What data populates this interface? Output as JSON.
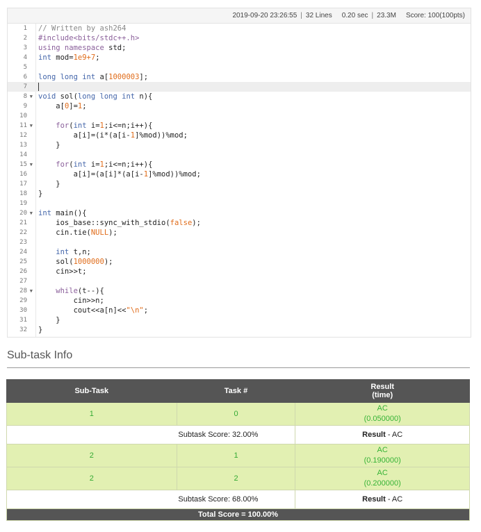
{
  "status": {
    "datetime": "2019-09-20 23:26:55",
    "lines": "32 Lines",
    "time": "0.20 sec",
    "memory": "23.3M",
    "score": "Score: 100(100pts)"
  },
  "code_lines": [
    {
      "n": "1",
      "fold": false
    },
    {
      "n": "2",
      "fold": false
    },
    {
      "n": "3",
      "fold": false
    },
    {
      "n": "4",
      "fold": false
    },
    {
      "n": "5",
      "fold": false
    },
    {
      "n": "6",
      "fold": false
    },
    {
      "n": "7",
      "fold": false
    },
    {
      "n": "8",
      "fold": true
    },
    {
      "n": "9",
      "fold": false
    },
    {
      "n": "10",
      "fold": false
    },
    {
      "n": "11",
      "fold": true
    },
    {
      "n": "12",
      "fold": false
    },
    {
      "n": "13",
      "fold": false
    },
    {
      "n": "14",
      "fold": false
    },
    {
      "n": "15",
      "fold": true
    },
    {
      "n": "16",
      "fold": false
    },
    {
      "n": "17",
      "fold": false
    },
    {
      "n": "18",
      "fold": false
    },
    {
      "n": "19",
      "fold": false
    },
    {
      "n": "20",
      "fold": true
    },
    {
      "n": "21",
      "fold": false
    },
    {
      "n": "22",
      "fold": false
    },
    {
      "n": "23",
      "fold": false
    },
    {
      "n": "24",
      "fold": false
    },
    {
      "n": "25",
      "fold": false
    },
    {
      "n": "26",
      "fold": false
    },
    {
      "n": "27",
      "fold": false
    },
    {
      "n": "28",
      "fold": true
    },
    {
      "n": "29",
      "fold": false
    },
    {
      "n": "30",
      "fold": false
    },
    {
      "n": "31",
      "fold": false
    },
    {
      "n": "32",
      "fold": false
    }
  ],
  "code": {
    "l1": "// Written by ash264",
    "l2": "#include<bits/stdc++.h>",
    "l3a": "using",
    "l3b": " namespace",
    "l3c": " std;",
    "l4a": "int",
    "l4b": " mod=",
    "l4c": "1e9+7",
    "l4d": ";",
    "l6a": "long long int",
    "l6b": " a[",
    "l6c": "1000003",
    "l6d": "];",
    "l8a": "void",
    "l8b": " sol(",
    "l8c": "long long int",
    "l8d": " n){",
    "l9a": "    a[",
    "l9b": "0",
    "l9c": "]=",
    "l9d": "1",
    "l9e": ";",
    "l11a": "    for",
    "l11b": "(",
    "l11c": "int",
    "l11d": " i=",
    "l11e": "1",
    "l11f": ";i<=n;i++){",
    "l12a": "        a[i]=(i*(a[i-",
    "l12b": "1",
    "l12c": "]%mod))%mod;",
    "l13": "    }",
    "l15a": "    for",
    "l15b": "(",
    "l15c": "int",
    "l15d": " i=",
    "l15e": "1",
    "l15f": ";i<=n;i++){",
    "l16a": "        a[i]=(a[i]*(a[i-",
    "l16b": "1",
    "l16c": "]%mod))%mod;",
    "l17": "    }",
    "l18": "}",
    "l20a": "int",
    "l20b": " main(){",
    "l21a": "    ios_base::sync_with_stdio(",
    "l21b": "false",
    "l21c": ");",
    "l22a": "    cin.tie(",
    "l22b": "NULL",
    "l22c": ");",
    "l24a": "    int",
    "l24b": " t,n;",
    "l25a": "    sol(",
    "l25b": "1000000",
    "l25c": ");",
    "l26a": "    cin>>t;",
    "l28a": "    while",
    "l28b": "(t--){",
    "l29": "        cin>>n;",
    "l30a": "        cout<<a[n]<<",
    "l30b": "\"\\n\"",
    "l30c": ";",
    "l31": "    }",
    "l32": "}"
  },
  "subtask": {
    "title": "Sub-task Info",
    "headers": {
      "subtask": "Sub-Task",
      "task": "Task #",
      "result_1": "Result",
      "result_2": "(time)"
    },
    "rows": [
      {
        "subtask": "1",
        "task": "0",
        "verdict": "AC",
        "time": "(0.050000)"
      },
      {
        "subtask": "2",
        "task": "1",
        "verdict": "AC",
        "time": "(0.190000)"
      },
      {
        "subtask": "2",
        "task": "2",
        "verdict": "AC",
        "time": "(0.200000)"
      }
    ],
    "scores": [
      {
        "label": "Subtask Score: 32.00%",
        "result_label": "Result",
        "result_value": " - AC"
      },
      {
        "label": "Subtask Score: 68.00%",
        "result_label": "Result",
        "result_value": " - AC"
      }
    ],
    "total": "Total Score = 100.00%"
  }
}
